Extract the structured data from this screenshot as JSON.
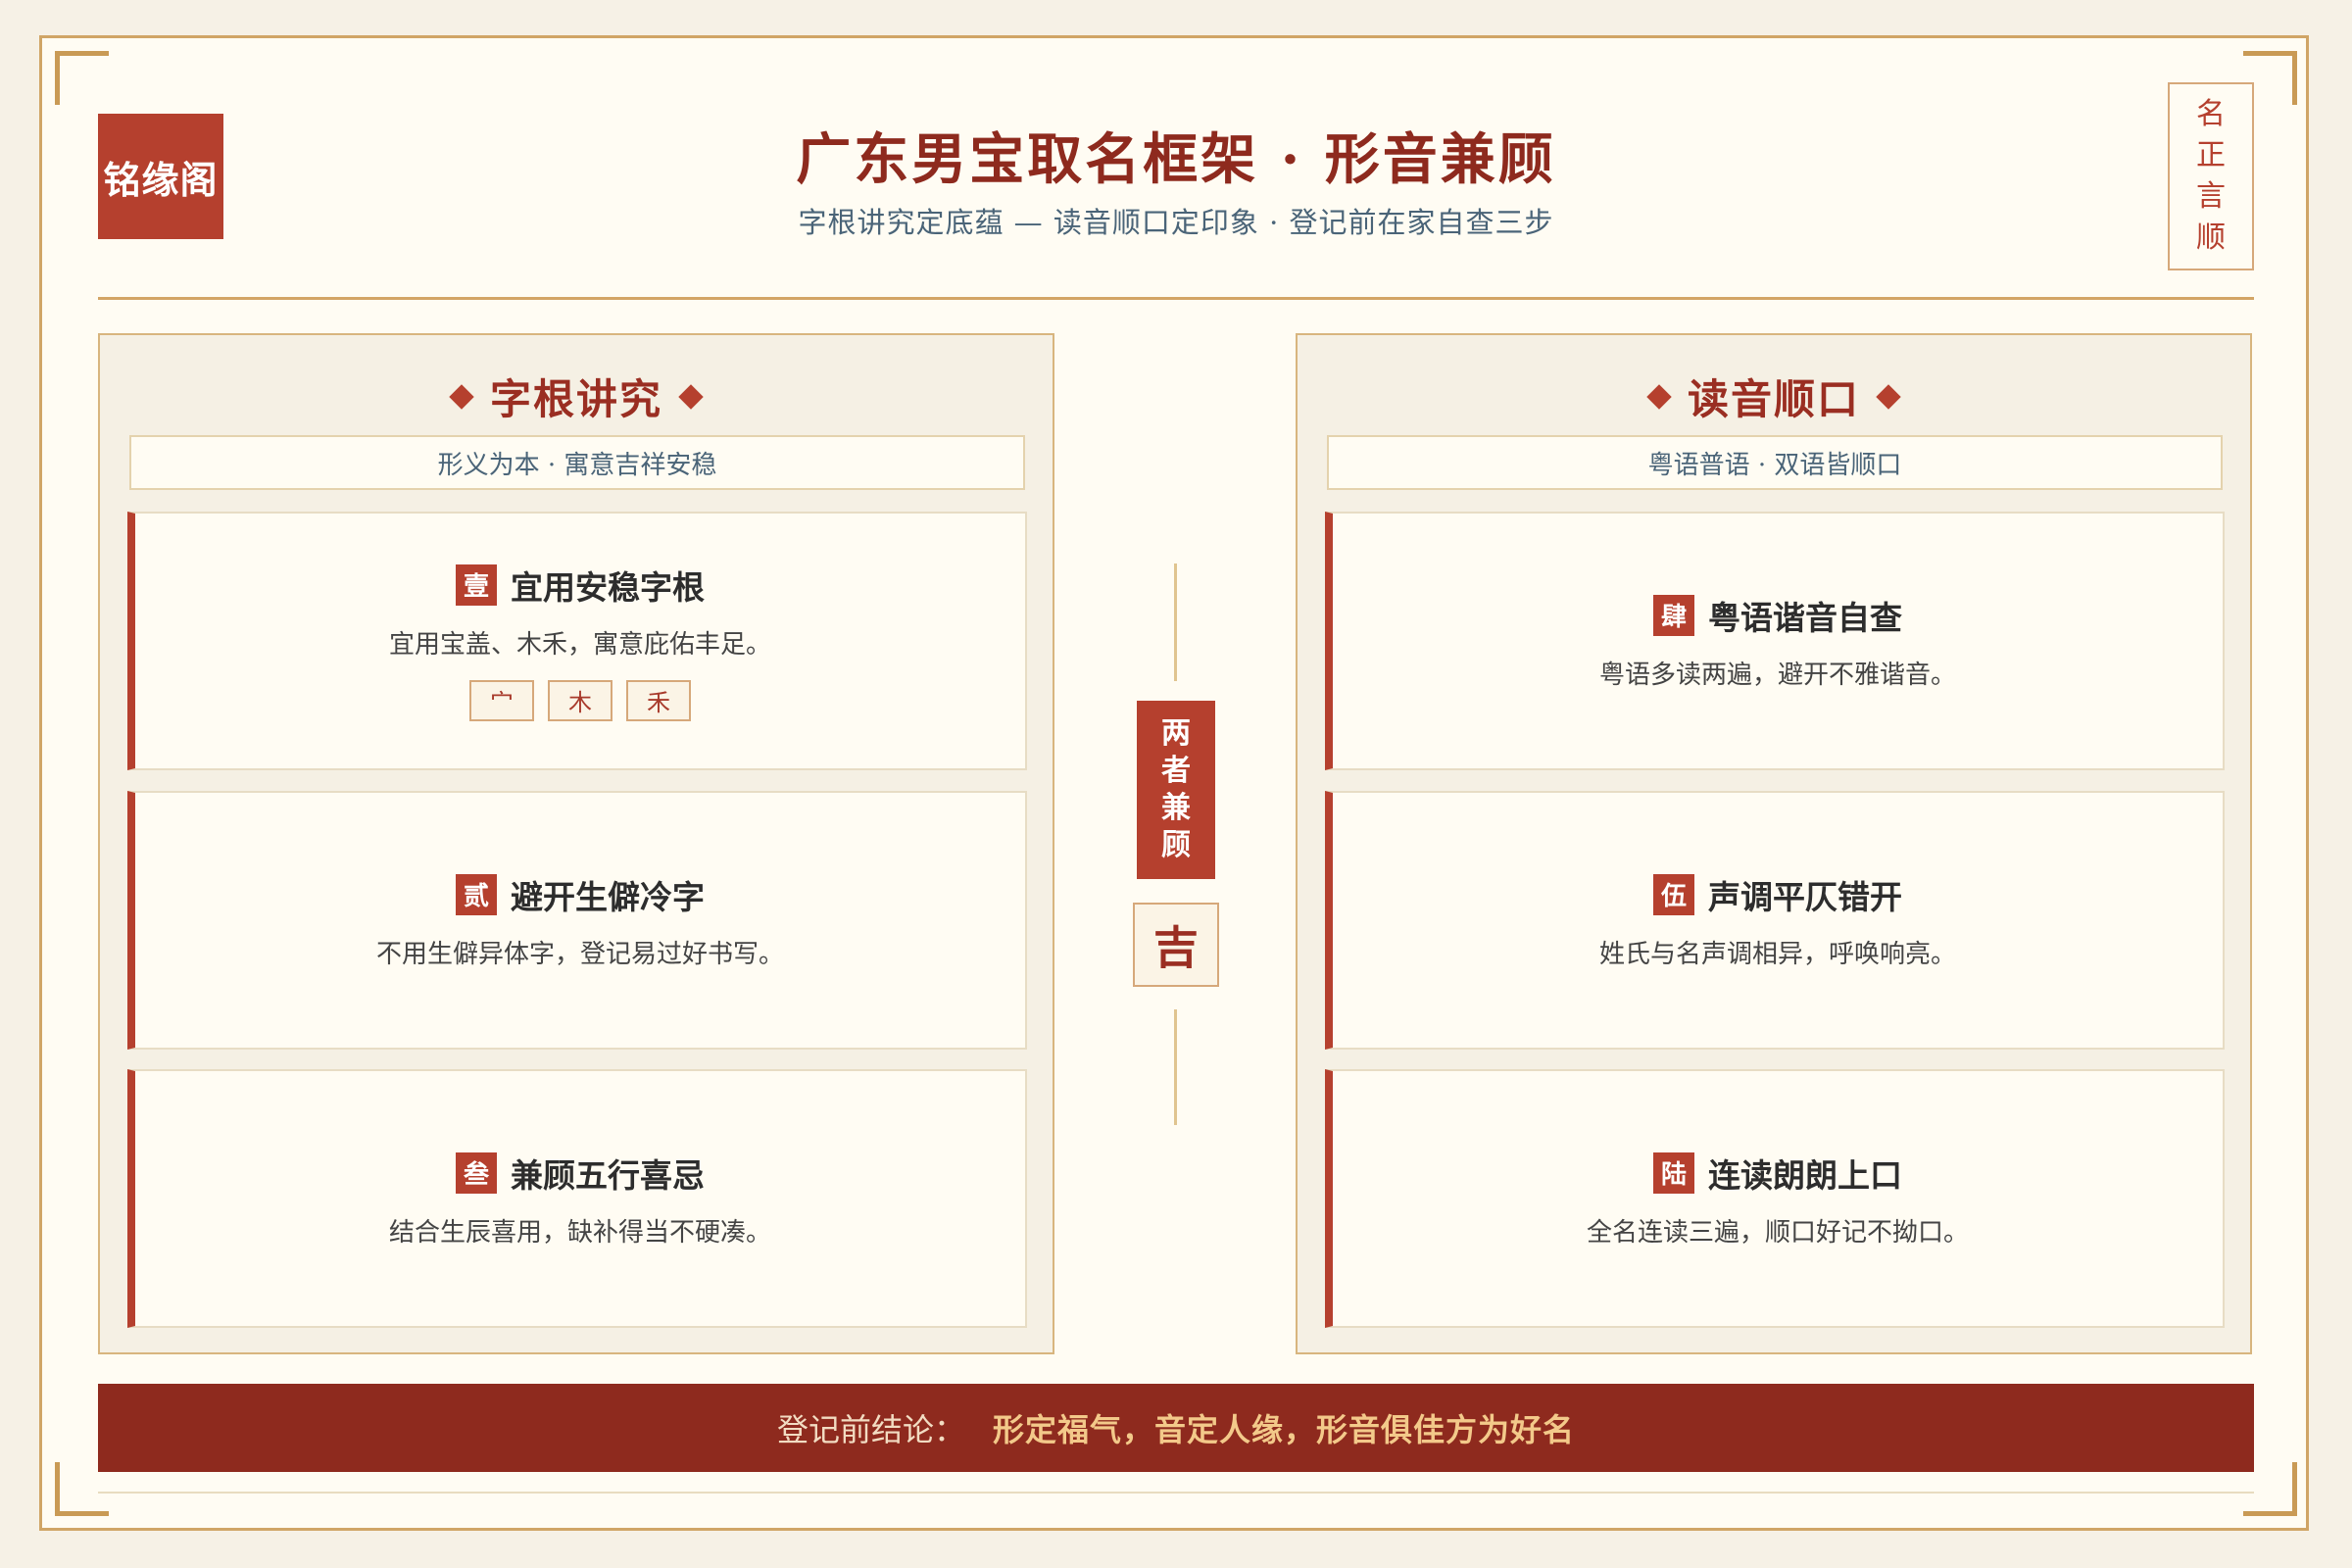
{
  "brand": {
    "logo_text": "铭缘阁",
    "seal_chars": [
      "名",
      "正",
      "言",
      "顺"
    ]
  },
  "header": {
    "title": "广东男宝取名框架 · 形音兼顾",
    "subtitle": "字根讲究定底蕴 — 读音顺口定印象 · 登记前在家自查三步"
  },
  "left_panel": {
    "title": "字根讲究",
    "subtitle": "形义为本 · 寓意吉祥安稳",
    "items": [
      {
        "num": "壹",
        "title": "宜用安稳字根",
        "desc": "宜用宝盖、木禾，寓意庇佑丰足。",
        "chips": [
          "宀",
          "木",
          "禾"
        ]
      },
      {
        "num": "贰",
        "title": "避开生僻冷字",
        "desc": "不用生僻异体字，登记易过好书写。"
      },
      {
        "num": "叁",
        "title": "兼顾五行喜忌",
        "desc": "结合生辰喜用，缺补得当不硬凑。"
      }
    ]
  },
  "right_panel": {
    "title": "读音顺口",
    "subtitle": "粤语普语 · 双语皆顺口",
    "items": [
      {
        "num": "肆",
        "title": "粤语谐音自查",
        "desc": "粤语多读两遍，避开不雅谐音。"
      },
      {
        "num": "伍",
        "title": "声调平仄错开",
        "desc": "姓氏与名声调相异，呼唤响亮。"
      },
      {
        "num": "陆",
        "title": "连读朗朗上口",
        "desc": "全名连读三遍，顺口好记不拗口。"
      }
    ]
  },
  "center": {
    "chars": [
      "两",
      "者",
      "兼",
      "顾"
    ],
    "ji": "吉"
  },
  "footer": {
    "label": "登记前结论：",
    "conclusion": "形定福气，音定人缘，形音俱佳方为好名"
  },
  "colors": {
    "accent": "#b5402e",
    "dark_red": "#8e2a1e",
    "gold": "#d3a565",
    "background": "#fffcf3",
    "blue_text": "#4a6478"
  }
}
